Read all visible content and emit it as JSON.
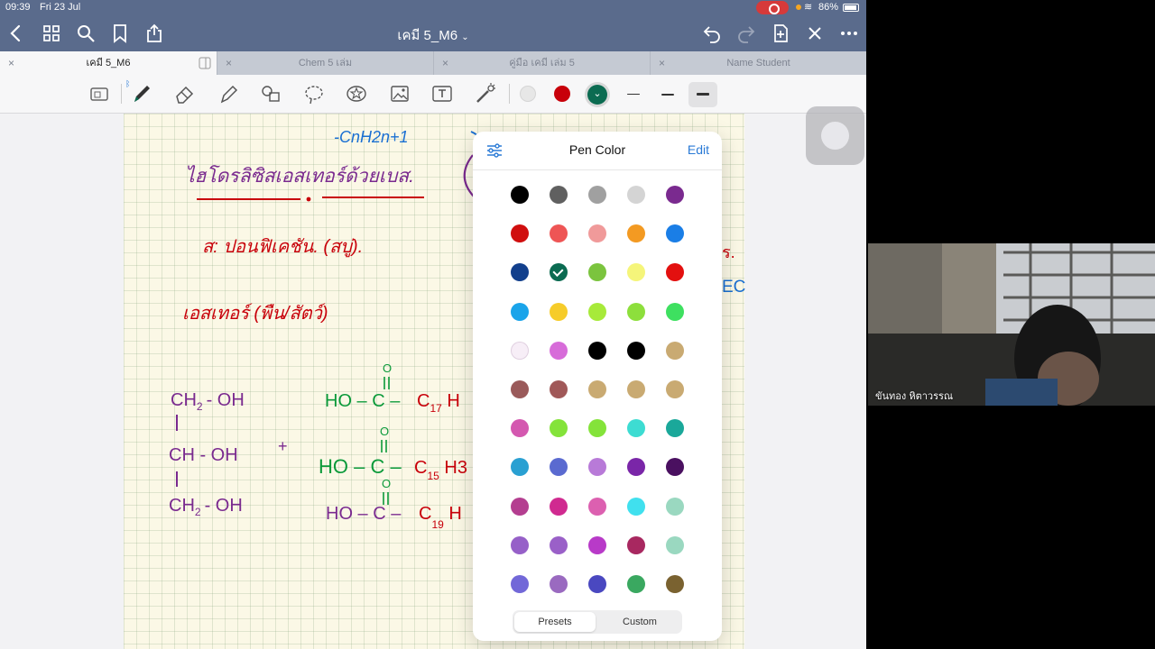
{
  "status_bar": {
    "time": "09:39",
    "date": "Fri 23 Jul",
    "battery": "86%"
  },
  "nav": {
    "doc_title": "เคมี 5_M6",
    "doc_title_chevron": "chevron-down-icon"
  },
  "tabs": [
    {
      "label": "เคมี 5_M6",
      "active": true
    },
    {
      "label": "Chem  5 เล่ม",
      "active": false
    },
    {
      "label": "คู่มือ เคมี เล่ม 5",
      "active": false
    },
    {
      "label": "Name Student",
      "active": false
    }
  ],
  "tab_close_glyph": "×",
  "toolbar": {
    "pen_colors": [
      "#e7e7e7",
      "#c8000a",
      "#0b6b51"
    ],
    "selected_pen_color": "#0b6b51",
    "stroke_widths": [
      "thin",
      "medium",
      "thick"
    ],
    "selected_stroke": "thick"
  },
  "popover": {
    "title": "Pen Color",
    "edit_label": "Edit",
    "settings_icon": "sliders-icon",
    "colors": [
      [
        "#000000",
        "#606060",
        "#a0a0a0",
        "#d4d4d4",
        "#7a2a8f"
      ],
      [
        "#d00e0e",
        "#ee5555",
        "#f09a9a",
        "#f39a22",
        "#1a7ee6"
      ],
      [
        "#123f8c",
        "#0b6b51",
        "#7bc43e",
        "#f5f57a",
        "#e3100f"
      ],
      [
        "#1aa4ea",
        "#f6cc2a",
        "#a7ea3a",
        "#8ddf3c",
        "#3ee060"
      ],
      [
        "#f7eef7",
        "#d76cd9",
        "#000000",
        "#000000",
        "#c9aa72"
      ],
      [
        "#9a5a5a",
        "#a05858",
        "#c9aa72",
        "#c9aa72",
        "#c9aa72"
      ],
      [
        "#d458b0",
        "#84e33a",
        "#84e33a",
        "#3ddcd2",
        "#1aa89a"
      ],
      [
        "#2aa0d2",
        "#5a6ad0",
        "#b87ad8",
        "#7a26a8",
        "#4a1060"
      ],
      [
        "#b43e90",
        "#d02a90",
        "#dc60b0",
        "#40e0ee",
        "#9ad8c0"
      ],
      [
        "#9660c8",
        "#9a60c8",
        "#b83ac8",
        "#a82860",
        "#9ad8c0"
      ],
      [
        "#7268d8",
        "#9a6ac0",
        "#4a48c0",
        "#3aa860",
        "#7a6230"
      ]
    ],
    "selected": [
      2,
      1
    ],
    "segments": [
      {
        "label": "Presets",
        "active": true
      },
      {
        "label": "Custom",
        "active": false
      }
    ]
  },
  "notes": {
    "title": "ไฮโดรลิซิสเอสเทอร์ด้วยเบส.",
    "line1": "ส: ปอนฟิเคชัน.  (สบู่).",
    "line2": "เอสเทอร์ (พืน/สัตว์)",
    "cnh": "-CnH2n+1",
    "glycerol": [
      "CH",
      "- OH",
      "CH  - OH",
      "CH",
      "- OH"
    ],
    "sub2": "2",
    "plus": "+",
    "acids": [
      {
        "prefix": "HO – C – ",
        "chain": "C",
        "sub": "17",
        "tail": " H"
      },
      {
        "prefix": "HO – C – ",
        "chain": "C",
        "sub": "15",
        "tail": " H3"
      },
      {
        "prefix": "HO – C – ",
        "chain": "C",
        "sub": "19",
        "tail": " H"
      }
    ],
    "carbonyl": "O",
    "side_r": "ร.",
    "side_c": "EC"
  },
  "participant": {
    "name": "ขันทอง หิตาวรรณ"
  }
}
